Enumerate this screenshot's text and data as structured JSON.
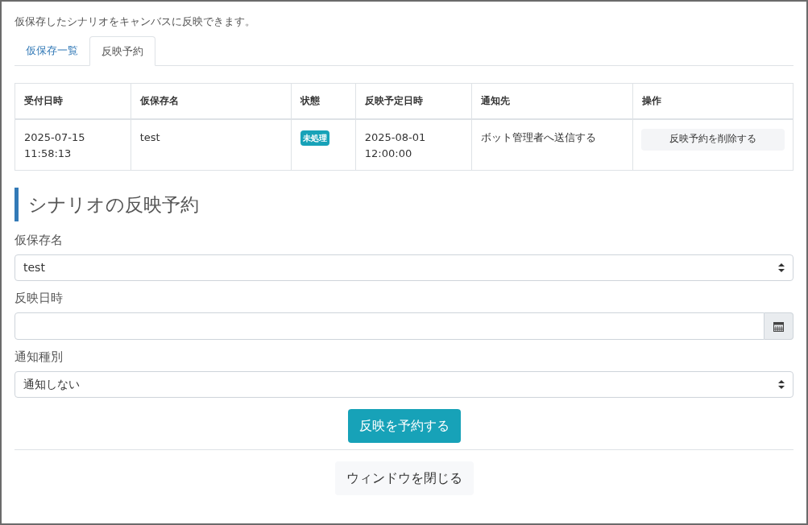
{
  "intro": "仮保存したシナリオをキャンバスに反映できます。",
  "tabs": [
    {
      "label": "仮保存一覧",
      "selected": false
    },
    {
      "label": "反映予約",
      "selected": true
    }
  ],
  "table": {
    "columns": [
      "受付日時",
      "仮保存名",
      "状態",
      "反映予定日時",
      "通知先",
      "操作"
    ],
    "rows": [
      {
        "received": "2025-07-15\n11:58:13",
        "name": "test",
        "status": "未処理",
        "scheduled": "2025-08-01\n12:00:00",
        "notify": "ボット管理者へ送信する",
        "action": "反映予約を削除する"
      }
    ]
  },
  "form": {
    "title": "シナリオの反映予約",
    "fields": [
      {
        "kind": "select",
        "label": "仮保存名",
        "value": "test"
      },
      {
        "kind": "date",
        "label": "反映日時"
      },
      {
        "kind": "select",
        "label": "通知種別",
        "value": "通知しない"
      }
    ],
    "submit": "反映を予約する"
  },
  "close_button": "ウィンドウを閉じる"
}
